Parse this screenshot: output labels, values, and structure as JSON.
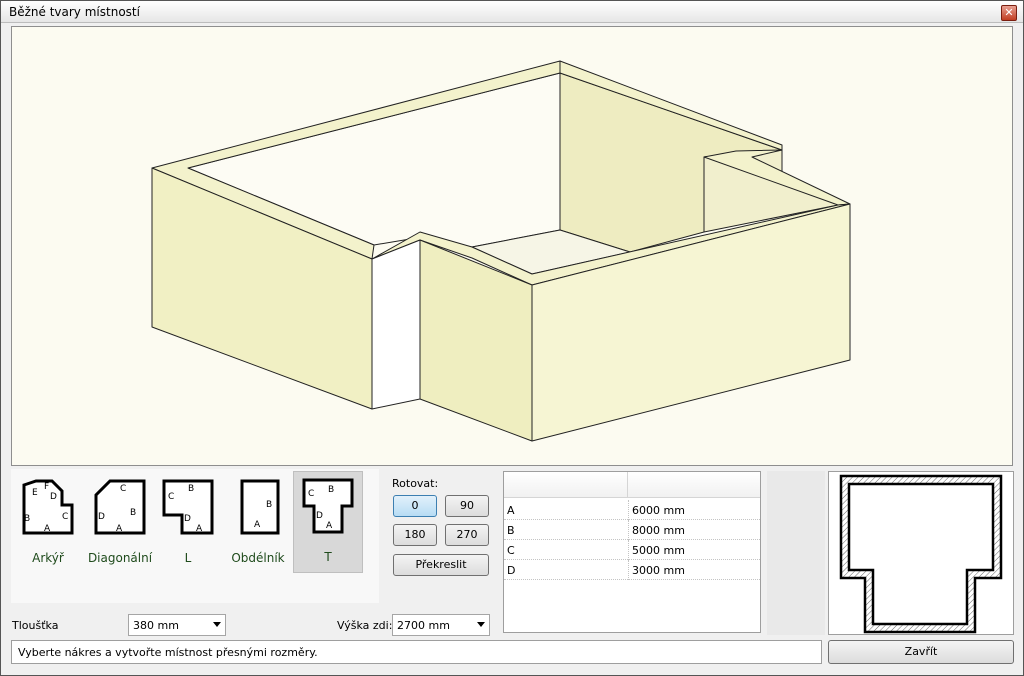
{
  "window": {
    "title": "Běžné tvary místností",
    "close_icon": "close-icon"
  },
  "shapes": [
    {
      "id": "arkyr",
      "label": "Arkýř",
      "letters": [
        "E",
        "F",
        "D",
        "B",
        "C",
        "A"
      ],
      "selected": false
    },
    {
      "id": "diagonal",
      "label": "Diagonální",
      "letters": [
        "C",
        "D",
        "B",
        "A"
      ],
      "selected": false
    },
    {
      "id": "l",
      "label": "L",
      "letters": [
        "C",
        "B",
        "D",
        "A"
      ],
      "selected": false
    },
    {
      "id": "rect",
      "label": "Obdélník",
      "letters": [
        "B",
        "A"
      ],
      "selected": false
    },
    {
      "id": "t",
      "label": "T",
      "letters": [
        "C",
        "B",
        "D",
        "A"
      ],
      "selected": true
    }
  ],
  "rotation": {
    "label": "Rotovat:",
    "options": [
      "0",
      "90",
      "180",
      "270"
    ],
    "selected": "0",
    "redraw_label": "Překreslit"
  },
  "dimensions": {
    "rows": [
      {
        "key": "A",
        "value": "6000 mm"
      },
      {
        "key": "B",
        "value": "8000 mm"
      },
      {
        "key": "C",
        "value": "5000 mm"
      },
      {
        "key": "D",
        "value": "3000 mm"
      }
    ]
  },
  "thickness": {
    "label": "Tloušťka",
    "value": "380 mm"
  },
  "wall_height": {
    "label": "Výška zdi:",
    "value": "2700 mm"
  },
  "status": {
    "text": "Vyberte nákres a vytvořte místnost přesnými rozměry."
  },
  "close_label": "Zavřít",
  "colors": {
    "wall": "#f3f2c9",
    "wall_dark": "#e9e8b4",
    "floor": "#fdfcf2"
  }
}
